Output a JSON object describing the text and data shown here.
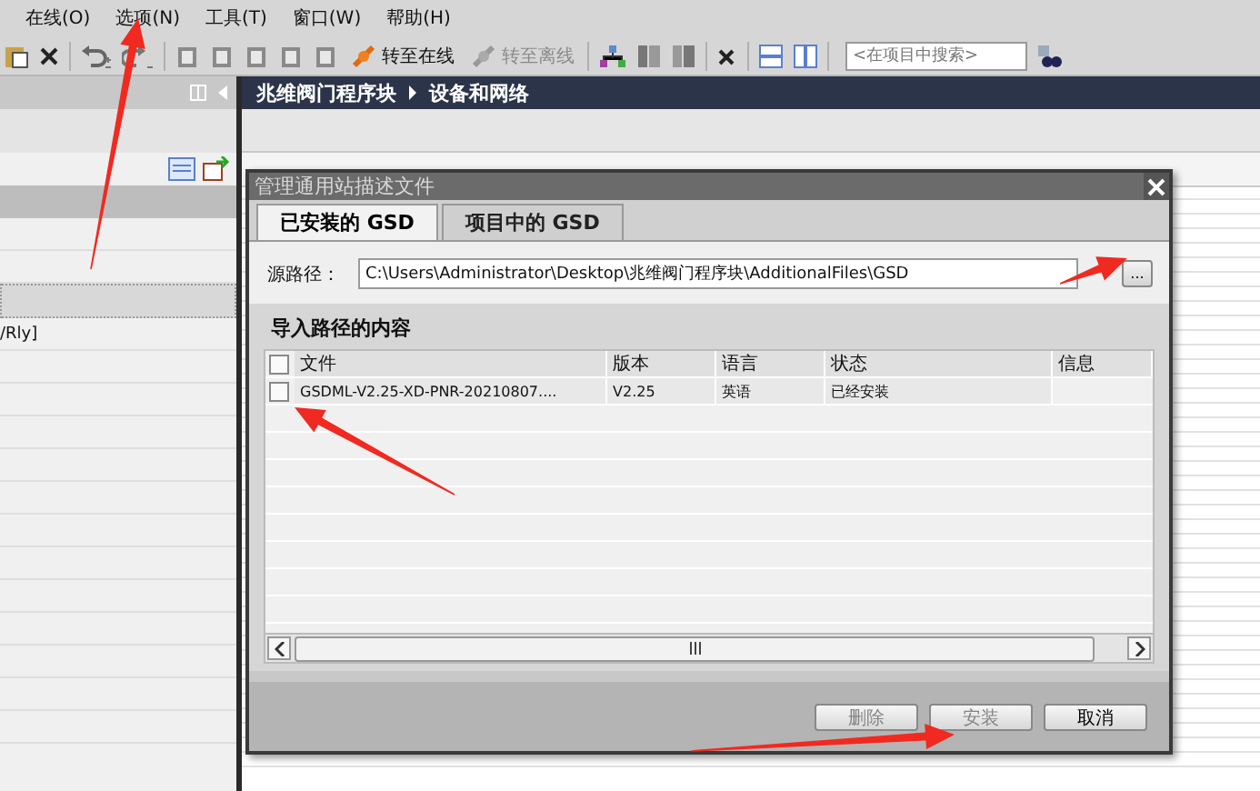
{
  "menu": [
    {
      "label": "在线(O)"
    },
    {
      "label": "选项(N)"
    },
    {
      "label": "工具(T)"
    },
    {
      "label": "窗口(W)"
    },
    {
      "label": "帮助(H)"
    }
  ],
  "toolbar": {
    "go_online": {
      "label": "转至在线",
      "disabled": false
    },
    "go_offline": {
      "label": "转至离线",
      "disabled": true
    },
    "search": {
      "placeholder": "<在项目中搜索>"
    }
  },
  "left_panel": {
    "rows": [
      {
        "text": "/Rly]"
      }
    ]
  },
  "breadcrumb": [
    "兆维阀门程序块",
    "设备和网络"
  ],
  "dialog": {
    "title": "管理通用站描述文件",
    "tabs": [
      {
        "label": "已安装的 GSD",
        "selected": true
      },
      {
        "label": "项目中的 GSD",
        "selected": false
      }
    ],
    "source_label": "源路径：",
    "source_path": "C:\\Users\\Administrator\\Desktop\\兆维阀门程序块\\AdditionalFiles\\GSD",
    "browse_button": "...",
    "section_title": "导入路径的内容",
    "table": {
      "header_checked": false,
      "columns": [
        "文件",
        "版本",
        "语言",
        "状态",
        "信息"
      ],
      "rows": [
        {
          "checked": false,
          "cells": [
            "GSDML-V2.25-XD-PNR-20210807....",
            "V2.25",
            "英语",
            "已经安装"
          ]
        }
      ]
    },
    "buttons": [
      {
        "label": "删除",
        "disabled": true
      },
      {
        "label": "安装",
        "disabled": true
      },
      {
        "label": "取消",
        "disabled": false
      }
    ]
  }
}
